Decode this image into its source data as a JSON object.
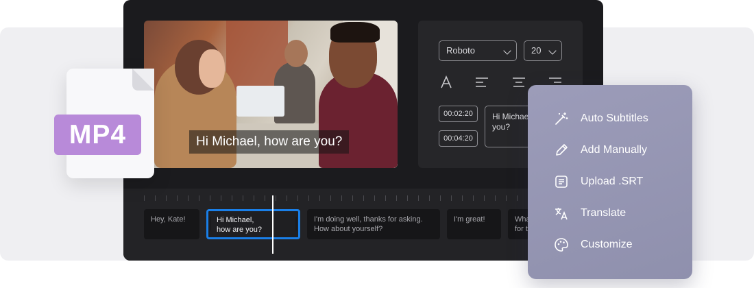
{
  "video": {
    "caption": "Hi Michael, how are you?"
  },
  "style_panel": {
    "font": "Roboto",
    "font_size": "20",
    "timestamps": [
      "00:02:20",
      "00:04:20"
    ],
    "text_preview": "Hi Michael, how are you?"
  },
  "timeline": {
    "clips": [
      {
        "line1": "Hey, Kate!",
        "line2": ""
      },
      {
        "line1": "Hi Michael,",
        "line2": "how are you?"
      },
      {
        "line1": "I'm doing well, thanks for asking.",
        "line2": "How about yourself?"
      },
      {
        "line1": "I'm great!",
        "line2": ""
      },
      {
        "line1": "What",
        "line2": "for t"
      }
    ]
  },
  "file_badge": {
    "label": "MP4"
  },
  "menu": {
    "items": [
      {
        "label": "Auto Subtitles",
        "icon": "magic-wand-icon"
      },
      {
        "label": "Add Manually",
        "icon": "pencil-icon"
      },
      {
        "label": "Upload .SRT",
        "icon": "document-icon"
      },
      {
        "label": "Translate",
        "icon": "translate-icon"
      },
      {
        "label": "Customize",
        "icon": "palette-icon"
      }
    ]
  },
  "colors": {
    "accent": "#1a7fe8",
    "badge": "#b88ad9",
    "menu_bg": "#9c9cb9",
    "editor_bg": "#1b1b1e"
  }
}
